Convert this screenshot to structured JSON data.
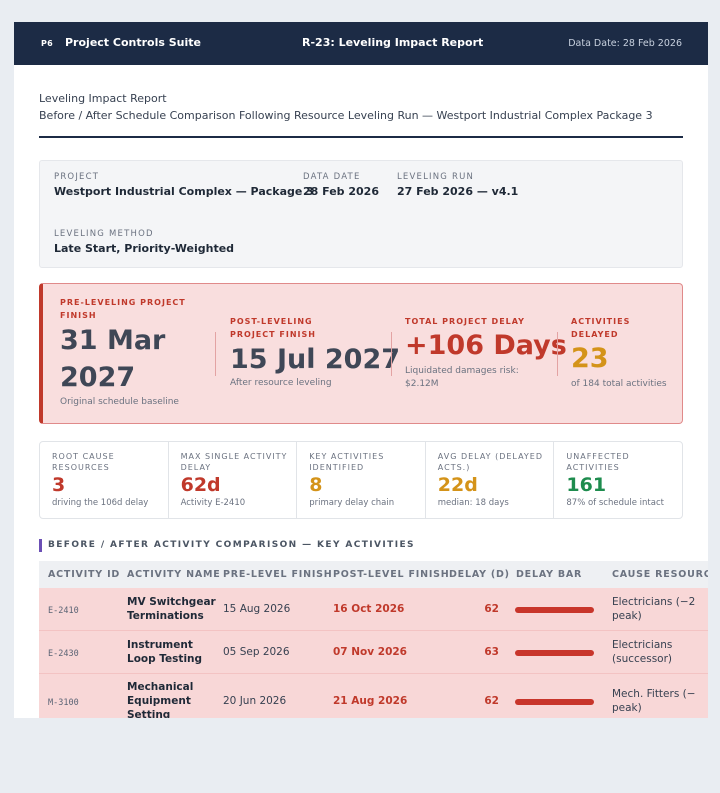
{
  "header": {
    "logo": "P6",
    "app_name": "Project Controls Suite",
    "report_title": "R-23: Leveling Impact Report",
    "data_date": "Data Date: 28 Feb 2026"
  },
  "title_block": {
    "title": "Leveling Impact Report",
    "subtitle": "Before / After Schedule Comparison Following Resource Leveling Run — Westport Industrial Complex Package 3"
  },
  "meta": {
    "project_label": "Project",
    "project_value": "Westport Industrial Complex — Package 3",
    "data_date_label": "Data Date",
    "data_date_value": "28 Feb 2026",
    "run_label": "Leveling Run",
    "run_value": "27 Feb 2026 — v4.1",
    "method_label": "Leveling Method",
    "method_value": "Late Start, Priority-Weighted"
  },
  "impact": {
    "pre_label": "Pre-Leveling Project Finish",
    "pre_value_line1": "31 Mar",
    "pre_value_line2": "2027",
    "pre_sub": "Original schedule baseline",
    "post_label": "Post-Leveling Project Finish",
    "post_value": "15 Jul 2027",
    "post_sub": "After resource leveling",
    "delay_label": "Total Project Delay",
    "delay_value": "+106 Days",
    "delay_sub_line1": "Liquidated damages risk:",
    "delay_sub_line2": "$2.12M",
    "acts_label": "Activities Delayed",
    "acts_value": "23",
    "acts_sub": "of 184 total activities"
  },
  "kpis": [
    {
      "label": "Root Cause Resources",
      "value": "3",
      "sub": "driving the 106d delay",
      "color": "#c0392b"
    },
    {
      "label": "Max Single Activity Delay",
      "value": "62d",
      "sub": "Activity E-2410",
      "color": "#c0392b"
    },
    {
      "label": "Key Activities Identified",
      "value": "8",
      "sub": "primary delay chain",
      "color": "#d49319"
    },
    {
      "label": "Avg Delay (Delayed Acts.)",
      "value": "22d",
      "sub": "median: 18 days",
      "color": "#d49319"
    },
    {
      "label": "Unaffected Activities",
      "value": "161",
      "sub": "87% of schedule intact",
      "color": "#1e8c4e"
    }
  ],
  "section": {
    "title": "BEFORE / AFTER ACTIVITY COMPARISON — KEY ACTIVITIES"
  },
  "table": {
    "columns": [
      "Activity ID",
      "Activity Name",
      "Pre-Level Finish",
      "Post-Level Finish",
      "Delay (d)",
      "Delay Bar",
      "Cause Resource"
    ],
    "rows": [
      {
        "id": "E-2410",
        "name1": "MV Switchgear",
        "name2": "Terminations",
        "name3": "",
        "pre": "15 Aug 2026",
        "post": "16 Oct 2026",
        "delay": "62",
        "delay_fraction": 1.0,
        "cause1": "Electricians (−2",
        "cause2": "peak)"
      },
      {
        "id": "E-2430",
        "name1": "Instrument",
        "name2": "Loop Testing",
        "name3": "",
        "pre": "05 Sep 2026",
        "post": "07 Nov 2026",
        "delay": "63",
        "delay_fraction": 1.0,
        "cause1": "Electricians",
        "cause2": "(successor)"
      },
      {
        "id": "M-3100",
        "name1": "Mechanical",
        "name2": "Equipment",
        "name3": "Setting",
        "pre": "20 Jun 2026",
        "post": "21 Aug 2026",
        "delay": "62",
        "delay_fraction": 1.0,
        "cause1": "Mech. Fitters (−",
        "cause2": "peak)"
      }
    ]
  },
  "colors": {
    "header_bg": "#1c2b45",
    "danger": "#c0392b",
    "warning": "#d49319",
    "success": "#1e8c4e",
    "impact_bg": "#f9dede"
  }
}
